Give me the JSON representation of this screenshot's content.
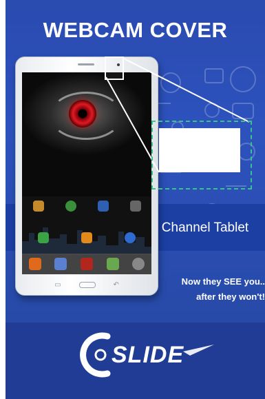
{
  "title": "WEBCAM COVER",
  "product_label": "Channel Tablet",
  "tagline_line1": "Now they SEE you..",
  "tagline_line2": "after they won't!",
  "logo_text": "SLIDE",
  "colors": {
    "background_blue": "#2a4bb0",
    "band_blue": "#1c3fa3",
    "dashed_green": "#39c28a",
    "iris_red": "#e01a23"
  },
  "icons": [
    "webcam-dot-icon",
    "zoom-outline-icon",
    "slide-logo-icon"
  ]
}
